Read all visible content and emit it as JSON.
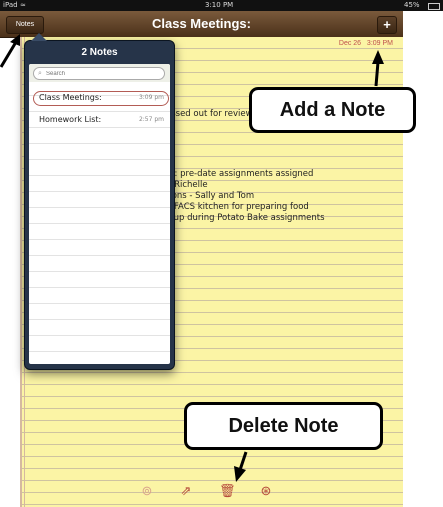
{
  "status": {
    "device": "iPad",
    "wifi": "wifi-icon",
    "time": "3:10 PM",
    "battery": "45%"
  },
  "navbar": {
    "notes_button": "Notes",
    "title": "Class Meetings:",
    "add_button": "+"
  },
  "note": {
    "date": "Dec 26",
    "time": "3:09 PM",
    "lines": [
      "assed out for review.",
      "e): pre-date assignments assigned",
      "d Richelle",
      "tions - Sally and Tom",
      "e FACS kitchen for preparing food",
      "k up during Potato Bake assignments"
    ]
  },
  "popover": {
    "title": "2 Notes",
    "search_placeholder": "Search",
    "items": [
      {
        "name": "Class Meetings:",
        "time": "3:09 pm"
      },
      {
        "name": "Homework List:",
        "time": "2:57 pm"
      }
    ]
  },
  "toolbar": {
    "icons": [
      "compass-icon",
      "share-icon",
      "trash-icon",
      "next-icon"
    ]
  },
  "callouts": {
    "add_note": "Add a Note",
    "delete_note": "Delete Note"
  },
  "colors": {
    "navbar": "#5e4129",
    "paper": "#fbf4a5",
    "accent": "#b5493a",
    "popover": "#263449"
  }
}
